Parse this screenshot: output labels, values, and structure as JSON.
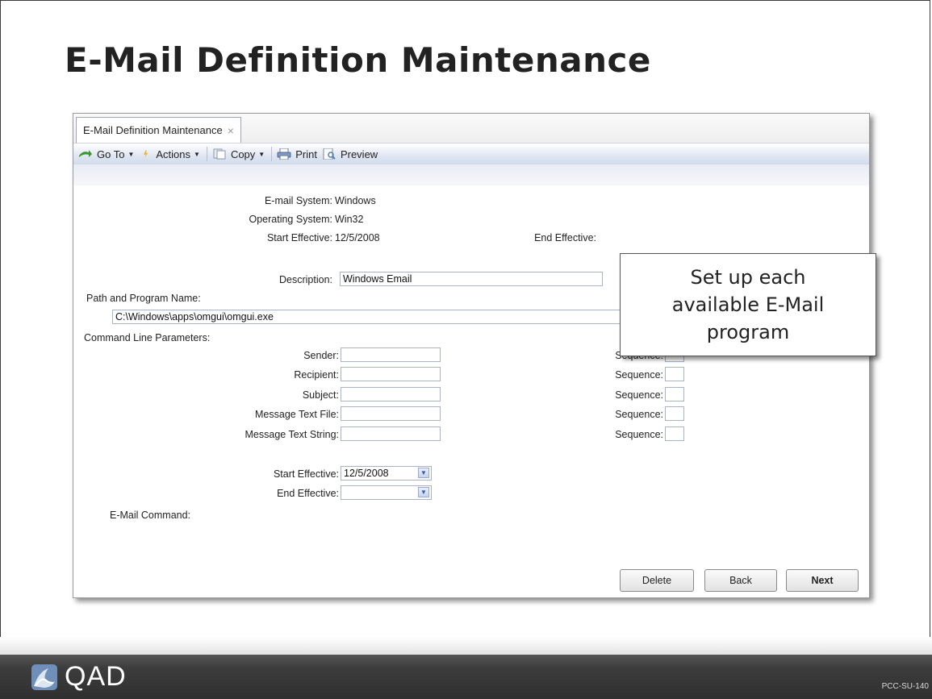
{
  "slide": {
    "title": "E-Mail Definition Maintenance",
    "logo_text": "QAD",
    "code": "PCC-SU-140"
  },
  "window": {
    "tab_label": "E-Mail Definition Maintenance",
    "tab_close": "×",
    "toolbar": {
      "goto": "Go To",
      "actions": "Actions",
      "copy": "Copy",
      "print": "Print",
      "preview": "Preview"
    }
  },
  "form": {
    "email_system_label": "E-mail System:",
    "email_system_value": "Windows",
    "os_label": "Operating System:",
    "os_value": "Win32",
    "start_eff_label": "Start Effective:",
    "start_eff_value": "12/5/2008",
    "end_eff_label": "End Effective:",
    "description_label": "Description:",
    "description_value": "Windows Email",
    "path_label": "Path and Program Name:",
    "path_value": "C:\\Windows\\apps\\omgui\\omgui.exe",
    "cmdline_label": "Command Line Parameters:",
    "params": [
      {
        "label": "Sender:",
        "value": "",
        "seq_label": "Sequence:",
        "seq_value": ""
      },
      {
        "label": "Recipient:",
        "value": "",
        "seq_label": "Sequence:",
        "seq_value": ""
      },
      {
        "label": "Subject:",
        "value": "",
        "seq_label": "Sequence:",
        "seq_value": ""
      },
      {
        "label": "Message Text File:",
        "value": "",
        "seq_label": "Sequence:",
        "seq_value": ""
      },
      {
        "label": "Message Text String:",
        "value": "",
        "seq_label": "Sequence:",
        "seq_value": ""
      }
    ],
    "start_eff2_label": "Start Effective:",
    "start_eff2_value": "12/5/2008",
    "end_eff2_label": "End Effective:",
    "end_eff2_value": "",
    "email_cmd_label": "E-Mail Command:"
  },
  "buttons": {
    "delete": "Delete",
    "back": "Back",
    "next": "Next"
  },
  "callout": {
    "line1": "Set up each",
    "line2": "available E-Mail",
    "line3": "program"
  }
}
